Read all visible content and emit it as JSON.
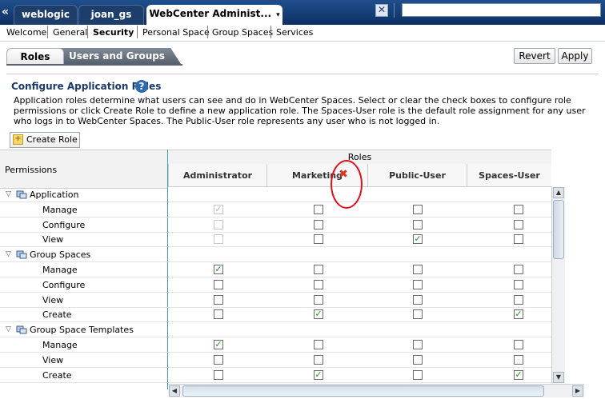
{
  "topbar": {
    "tabs": [
      {
        "label": "weblogic"
      },
      {
        "label": "joan_gs"
      },
      {
        "label": "WebCenter Administ...",
        "chevron": "▾"
      }
    ],
    "close_icon": "close-icon"
  },
  "nav": {
    "items": [
      "Welcome",
      "General",
      "Security",
      "Personal Space",
      "Group Spaces",
      "Services"
    ],
    "active": "Security"
  },
  "subtabs": {
    "roles": "Roles",
    "users": "Users and Groups"
  },
  "actions": {
    "revert": "Revert",
    "apply": "Apply"
  },
  "section": {
    "title": "Configure Application Roles",
    "help": "?",
    "description": "Application roles determine what users can see and do in WebCenter Spaces. Select or clear the check boxes to configure role permissions or click Create Role to define a new application role. The Spaces-User role is the default role assignment for any user who logs in to WebCenter Spaces. The Public-User role represents any user who is not logged in.",
    "create_role": "Create Role"
  },
  "table": {
    "permissions_header": "Permissions",
    "roles_header": "Roles",
    "roles": [
      "Administrator",
      "Marketing",
      "Public-User",
      "Spaces-User"
    ],
    "groups": [
      {
        "name": "Application",
        "permissions": [
          {
            "name": "Manage",
            "values": [
              "checked-disabled",
              "unchecked",
              "unchecked",
              "unchecked"
            ]
          },
          {
            "name": "Configure",
            "values": [
              "unchecked-disabled",
              "unchecked",
              "unchecked",
              "unchecked"
            ]
          },
          {
            "name": "View",
            "values": [
              "unchecked-disabled",
              "unchecked",
              "checked",
              "unchecked"
            ]
          }
        ]
      },
      {
        "name": "Group Spaces",
        "permissions": [
          {
            "name": "Manage",
            "values": [
              "checked",
              "unchecked",
              "unchecked",
              "unchecked"
            ]
          },
          {
            "name": "Configure",
            "values": [
              "unchecked",
              "unchecked",
              "unchecked",
              "unchecked"
            ]
          },
          {
            "name": "View",
            "values": [
              "unchecked",
              "unchecked",
              "unchecked",
              "unchecked"
            ]
          },
          {
            "name": "Create",
            "values": [
              "unchecked",
              "checked",
              "unchecked",
              "checked"
            ]
          }
        ]
      },
      {
        "name": "Group Space Templates",
        "permissions": [
          {
            "name": "Manage",
            "values": [
              "checked",
              "unchecked",
              "unchecked",
              "unchecked"
            ]
          },
          {
            "name": "View",
            "values": [
              "unchecked",
              "unchecked",
              "unchecked",
              "unchecked"
            ]
          },
          {
            "name": "Create",
            "values": [
              "unchecked",
              "checked",
              "unchecked",
              "checked"
            ]
          }
        ]
      }
    ]
  },
  "colors": {
    "topbar": "#1d3d6b",
    "accent_divider": "#3b9cc6",
    "check": "#1a9a1a",
    "annotation": "#e0101a"
  }
}
